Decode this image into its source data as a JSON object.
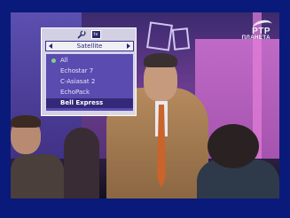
{
  "channel_logo": {
    "line1": "РТР",
    "line2": "ПЛАНЕТА"
  },
  "menu": {
    "top_icons": [
      "wrench-icon",
      "tv-icon"
    ],
    "tv_icon_text": "tv",
    "header_label": "Satellite",
    "items": [
      {
        "label": "All",
        "active": true
      },
      {
        "label": "Echostar 7"
      },
      {
        "label": "C-Asiasat 2"
      },
      {
        "label": "EchoPack"
      },
      {
        "label": "Bell Express",
        "selected": true
      }
    ]
  }
}
